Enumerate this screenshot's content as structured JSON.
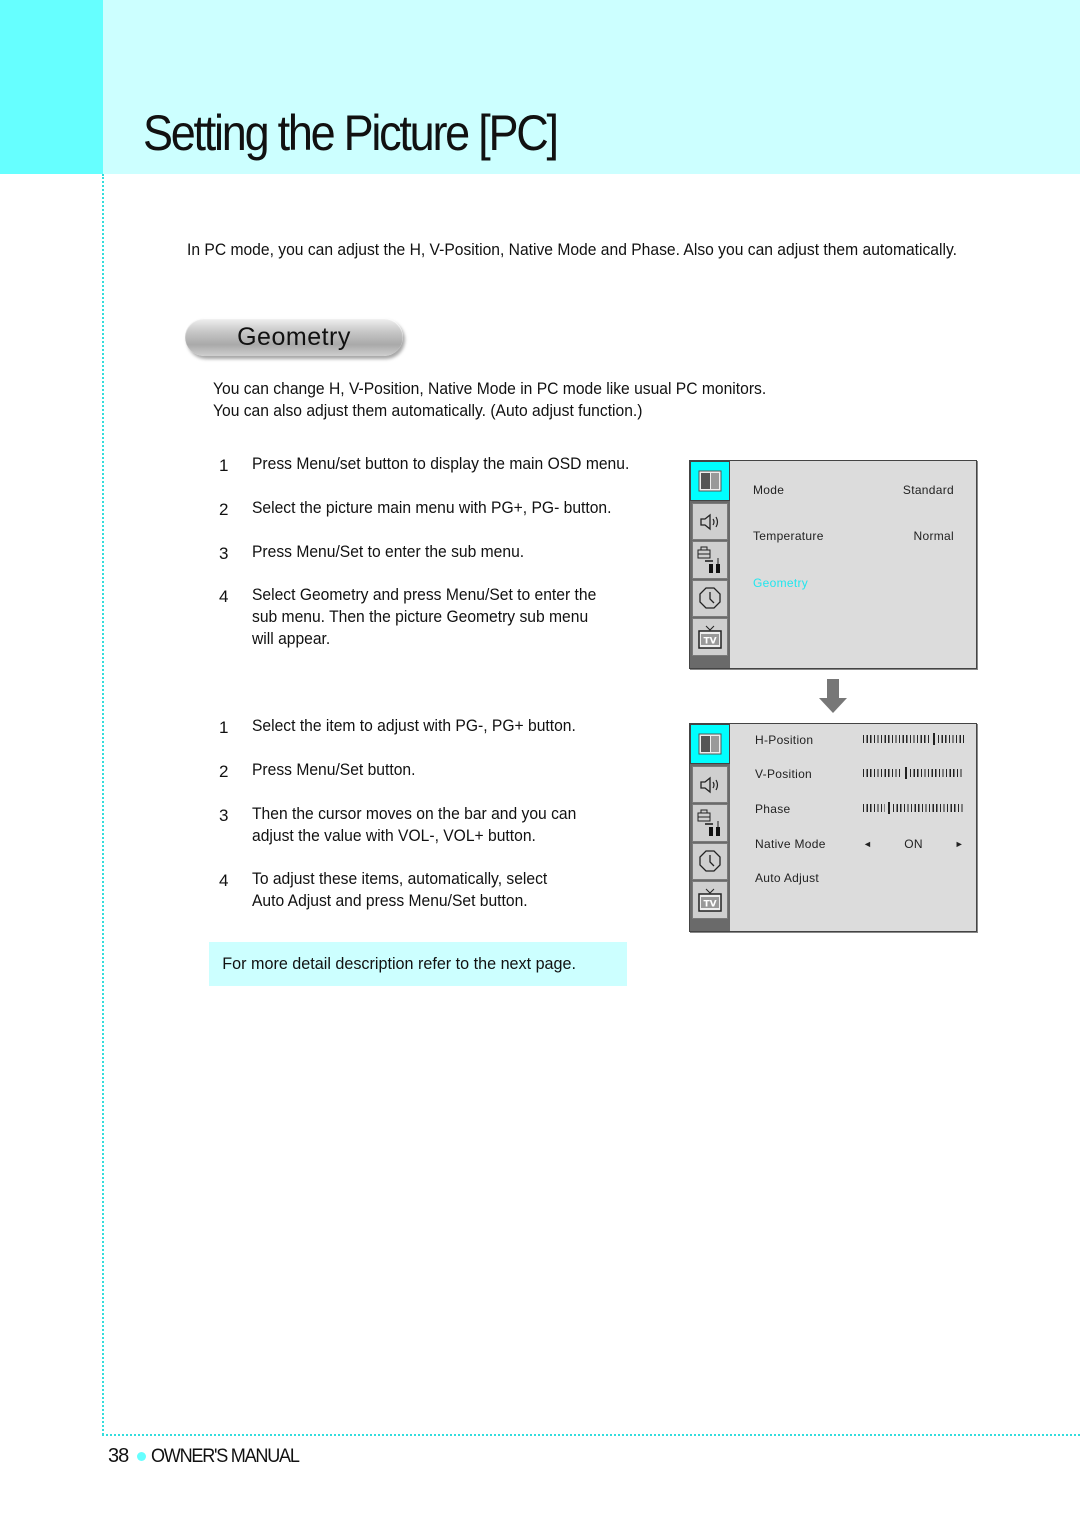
{
  "page": {
    "title": "Setting the Picture [PC]",
    "intro": "In PC mode, you can adjust the H, V-Position, Native Mode and Phase. Also you can adjust them automatically.",
    "colors": {
      "header_band": "#ccffff",
      "header_accent": "#66ffff",
      "highlight": "#00ffff",
      "osd_bg": "#dcdcdc"
    }
  },
  "section": {
    "title": "Geometry",
    "description": [
      "You can change H, V-Position, Native Mode in PC mode like usual PC monitors.",
      "You can also adjust them automatically. (Auto adjust function.)"
    ]
  },
  "steps_a": [
    {
      "num": "1",
      "lines": [
        "Press Menu/set button to display the main OSD menu."
      ]
    },
    {
      "num": "2",
      "lines": [
        "Select the picture main menu with PG+, PG- button."
      ]
    },
    {
      "num": "3",
      "lines": [
        "Press Menu/Set to enter the sub menu."
      ]
    },
    {
      "num": "4",
      "lines": [
        "Select Geometry and press Menu/Set to enter the",
        "sub menu. Then the picture Geometry sub menu",
        "will appear."
      ]
    }
  ],
  "steps_b": [
    {
      "num": "1",
      "lines": [
        "Select the item to adjust with PG-, PG+ button."
      ]
    },
    {
      "num": "2",
      "lines": [
        "Press Menu/Set button."
      ]
    },
    {
      "num": "3",
      "lines": [
        "Then the cursor moves on the bar and you can",
        "adjust the value with VOL-, VOL+ button."
      ]
    },
    {
      "num": "4",
      "lines": [
        "To adjust these items, automatically, select",
        "Auto Adjust and press Menu/Set button."
      ]
    }
  ],
  "note": "For more detail description refer to the next page.",
  "osd_icons": [
    "picture-icon",
    "sound-icon",
    "setup-tools-icon",
    "clock-icon",
    "tv-icon"
  ],
  "osd_main": {
    "rows": [
      {
        "label": "Mode",
        "value": "Standard"
      },
      {
        "label": "Temperature",
        "value": "Normal"
      },
      {
        "label": "Geometry",
        "value": "",
        "highlighted": true
      }
    ]
  },
  "osd_geometry": {
    "rows": [
      {
        "label": "H-Position",
        "type": "bar",
        "level": 0.72
      },
      {
        "label": "V-Position",
        "type": "bar",
        "level": 0.42
      },
      {
        "label": "Phase",
        "type": "bar",
        "level": 0.24
      },
      {
        "label": "Native Mode",
        "type": "select",
        "value": "ON",
        "left_arrow": "◄",
        "right_arrow": "►"
      },
      {
        "label": "Auto Adjust",
        "type": "action"
      }
    ]
  },
  "footer": {
    "page_number": "38",
    "label": "OWNER'S MANUAL"
  }
}
